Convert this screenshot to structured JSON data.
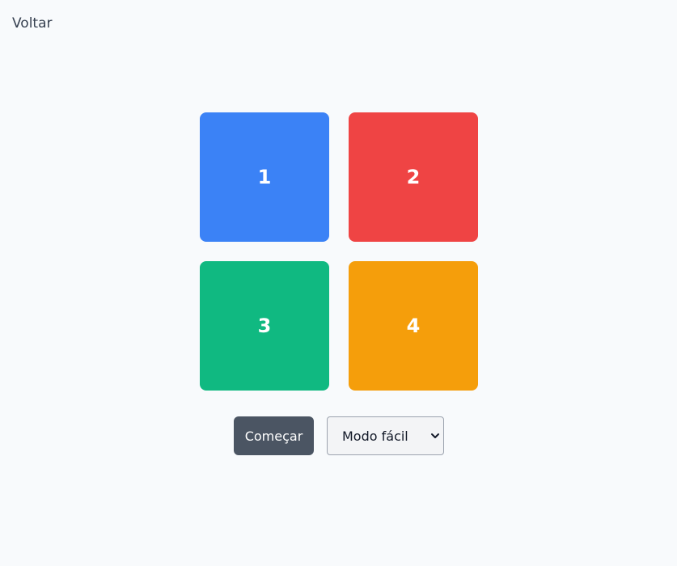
{
  "nav": {
    "back_label": "Voltar"
  },
  "pads": [
    {
      "label": "1",
      "color": "#3b82f6"
    },
    {
      "label": "2",
      "color": "#ef4444"
    },
    {
      "label": "3",
      "color": "#10b981"
    },
    {
      "label": "4",
      "color": "#f59e0b"
    }
  ],
  "controls": {
    "start_label": "Começar",
    "start_color": "#4b5563",
    "mode_selected": "Modo fácil",
    "mode_icon": "chevron-down-icon"
  }
}
